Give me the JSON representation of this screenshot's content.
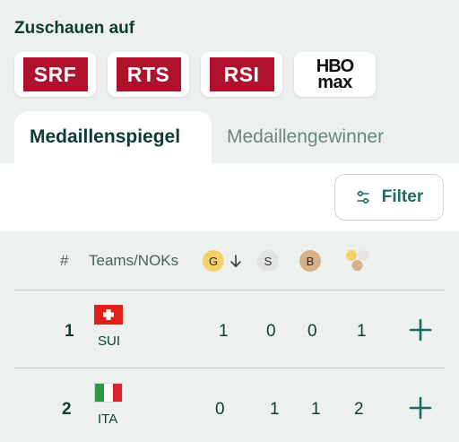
{
  "watch": {
    "title": "Zuschauen auf"
  },
  "broadcasters": [
    {
      "label": "SRF"
    },
    {
      "label": "RTS"
    },
    {
      "label": "RSI"
    },
    {
      "label_top": "HBO",
      "label_bottom": "max"
    }
  ],
  "tabs": [
    {
      "label": "Medaillenspiegel",
      "active": true
    },
    {
      "label": "Medaillengewinner",
      "active": false
    }
  ],
  "filter": {
    "label": "Filter",
    "icon": "sliders-icon"
  },
  "table": {
    "headers": {
      "rank": "#",
      "team": "Teams/NOKs",
      "gold": "G",
      "silver": "S",
      "bronze": "B"
    },
    "sort_icon": "arrow-down-icon",
    "total_icon": "medal-cluster-icon",
    "rows": [
      {
        "rank": "1",
        "code": "SUI",
        "flag": "switzerland-flag",
        "gold": "1",
        "silver": "0",
        "bronze": "0",
        "total": "1"
      },
      {
        "rank": "2",
        "code": "ITA",
        "flag": "italy-flag",
        "gold": "0",
        "silver": "1",
        "bronze": "1",
        "total": "2"
      }
    ]
  },
  "colors": {
    "gold": "#f5cf6a",
    "silver": "#e3e3e3",
    "bronze": "#d9b189",
    "accent": "#1b6b66",
    "srf_red": "#b0122e"
  }
}
